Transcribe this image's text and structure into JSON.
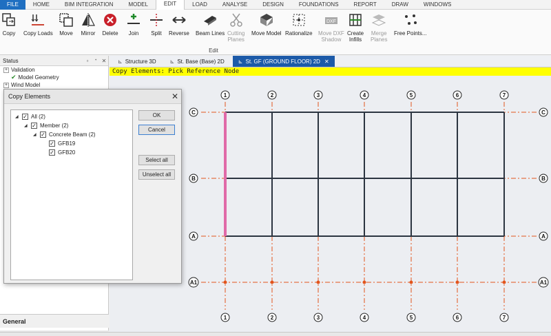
{
  "menu_tabs": [
    "FILE",
    "HOME",
    "BIM INTEGRATION",
    "MODEL",
    "EDIT",
    "LOAD",
    "ANALYSE",
    "DESIGN",
    "FOUNDATIONS",
    "REPORT",
    "DRAW",
    "WINDOWS"
  ],
  "active_menu_tab": "EDIT",
  "ribbon": {
    "buttons": [
      {
        "label": "Copy",
        "icon": "copy-icon"
      },
      {
        "label": "Copy Loads",
        "icon": "copy-loads-icon"
      },
      {
        "label": "Move",
        "icon": "move-icon"
      },
      {
        "label": "Mirror",
        "icon": "mirror-icon"
      },
      {
        "label": "Delete",
        "icon": "delete-icon"
      },
      {
        "label": "Join",
        "icon": "join-icon"
      },
      {
        "label": "Split",
        "icon": "split-icon"
      },
      {
        "label": "Reverse",
        "icon": "reverse-icon"
      },
      {
        "label": "Beam Lines",
        "icon": "beam-lines-icon"
      },
      {
        "label": "Cutting\nPlanes",
        "icon": "scissors-icon",
        "disabled": true
      },
      {
        "label": "Move Model",
        "icon": "move-model-icon"
      },
      {
        "label": "Rationalize",
        "icon": "rationalize-icon"
      },
      {
        "label": "Move DXF\nShadow",
        "icon": "dxf-icon",
        "disabled": true
      },
      {
        "label": "Create\nInfills",
        "icon": "infills-icon"
      },
      {
        "label": "Merge\nPlanes",
        "icon": "merge-planes-icon",
        "disabled": true
      },
      {
        "label": "Free Points...",
        "icon": "free-points-icon"
      }
    ],
    "group_label": "Edit"
  },
  "left_panel": {
    "title": "Status",
    "items": [
      {
        "label": "Validation"
      },
      {
        "label": "Model Geometry"
      },
      {
        "label": "Wind Model"
      }
    ],
    "footer": "General"
  },
  "doc_tabs": [
    {
      "label": "Structure 3D",
      "active": false
    },
    {
      "label": "St. Base (Base) 2D",
      "active": false
    },
    {
      "label": "St. GF (GROUND FLOOR) 2D",
      "active": true
    }
  ],
  "status_message": "Copy Elements: Pick Reference Node",
  "dialog": {
    "title": "Copy Elements",
    "tree": [
      {
        "label": "All (2)",
        "level": 0,
        "toggle": "▲"
      },
      {
        "label": "Member (2)",
        "level": 1,
        "toggle": "▲"
      },
      {
        "label": "Concrete Beam (2)",
        "level": 2,
        "toggle": "▲"
      },
      {
        "label": "GFB19",
        "level": 3,
        "toggle": ""
      },
      {
        "label": "GFB20",
        "level": 3,
        "toggle": ""
      }
    ],
    "ok_label": "OK",
    "cancel_label": "Cancel",
    "select_all_label": "Select all",
    "unselect_all_label": "Unselect all"
  },
  "grid": {
    "columns": [
      "1",
      "2",
      "3",
      "4",
      "5",
      "6",
      "7"
    ],
    "rows": [
      "C",
      "B",
      "A",
      "A1"
    ],
    "grid_color": "#e2541c",
    "beam_color": "#2b3440",
    "highlight_color": "#e06aa8"
  }
}
